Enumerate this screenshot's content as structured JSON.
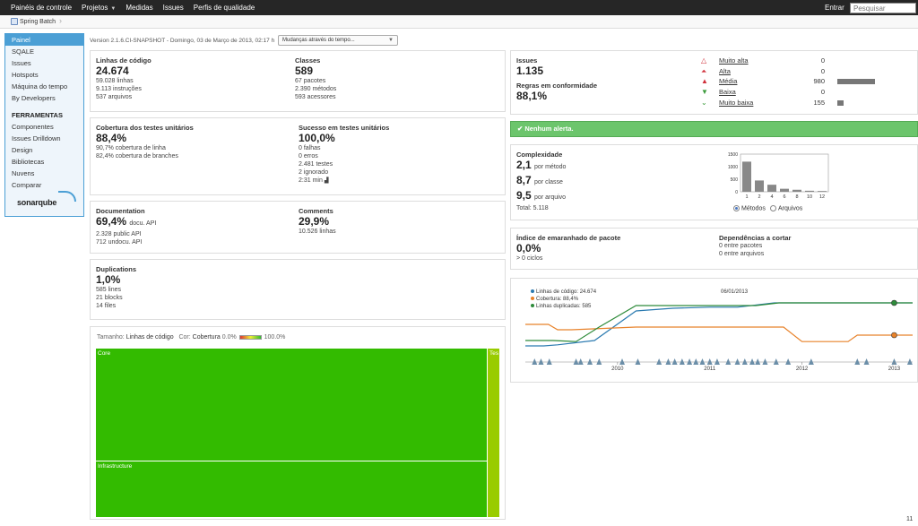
{
  "topnav": {
    "items": [
      "Painéis de controle",
      "Projetos",
      "Medidas",
      "Issues",
      "Perfis de qualidade"
    ],
    "login": "Entrar",
    "search_placeholder": "Pesquisar"
  },
  "breadcrumb": {
    "project": "Spring Batch"
  },
  "sidebar": {
    "items": [
      "Painel",
      "SQALE",
      "Issues",
      "Hotspots",
      "Máquina do tempo",
      "By Developers"
    ],
    "tools_header": "FERRAMENTAS",
    "tools": [
      "Componentes",
      "Issues Drilldown",
      "Design",
      "Bibliotecas",
      "Nuvens",
      "Comparar"
    ],
    "logo": "sonarqube"
  },
  "version_line": "Version 2.1.6.CI-SNAPSHOT - Domingo, 03 de Março de 2013, 02:17 h",
  "compare_dropdown": "Mudanças através do tempo...",
  "size": {
    "loc_title": "Linhas de código",
    "loc_value": "24.674",
    "loc_lines": "59.028 linhas",
    "loc_instr": "9.113 instruções",
    "loc_files": "537 arquivos",
    "classes_title": "Classes",
    "classes_value": "589",
    "classes_pkgs": "67 pacotes",
    "classes_methods": "2.390 métodos",
    "classes_accessors": "593 acessores"
  },
  "tests": {
    "cov_title": "Cobertura dos testes unitários",
    "cov_value": "88,4%",
    "cov_line": "90,7% cobertura de linha",
    "cov_branch": "82,4% cobertura de branches",
    "succ_title": "Sucesso em testes unitários",
    "succ_value": "100,0%",
    "failures": "0 falhas",
    "errors": "0 erros",
    "tests": "2.481 testes",
    "ignored": "2 ignorado",
    "duration": "2:31 min"
  },
  "docs": {
    "doc_title": "Documentation",
    "doc_value": "69,4%",
    "doc_unit": "docu. API",
    "public_api": "2.328 public API",
    "undoc_api": "712 undocu. API",
    "com_title": "Comments",
    "com_value": "29,9%",
    "com_lines": "10.526 linhas"
  },
  "dups": {
    "title": "Duplications",
    "value": "1,0%",
    "lines": "585 lines",
    "blocks": "21 blocks",
    "files": "14 files"
  },
  "treemap": {
    "size_label": "Tamanho:",
    "size_metric": "Linhas de código",
    "color_label": "Cor:",
    "color_metric": "Cobertura",
    "min": "0.0%",
    "max": "100.0%",
    "tiles": [
      "Core",
      "Infrastructure",
      "Tes"
    ]
  },
  "issues": {
    "title": "Issues",
    "value": "1.135",
    "rules_title": "Regras em conformidade",
    "rules_value": "88,1%",
    "severities": [
      {
        "label": "Muito alta",
        "count": "0",
        "fraction": 0,
        "color": "#d02f3a",
        "icon": "blocker-icon"
      },
      {
        "label": "Alta",
        "count": "0",
        "fraction": 0,
        "color": "#d02f3a",
        "icon": "critical-icon"
      },
      {
        "label": "Média",
        "count": "980",
        "fraction": 1.0,
        "color": "#d02f3a",
        "icon": "major-icon"
      },
      {
        "label": "Baixa",
        "count": "0",
        "fraction": 0,
        "color": "#3c9b3c",
        "icon": "minor-icon"
      },
      {
        "label": "Muito baixa",
        "count": "155",
        "fraction": 0.158,
        "color": "#3c9b3c",
        "icon": "info-icon"
      }
    ]
  },
  "alerts": {
    "text": "Nenhum alerta.",
    "color": "#6cc56c"
  },
  "complexity": {
    "title": "Complexidade",
    "per_method": "2,1",
    "per_method_unit": "por método",
    "per_class": "8,7",
    "per_class_unit": "por classe",
    "per_file": "9,5",
    "per_file_unit": "por arquivo",
    "total": "Total: 5.118",
    "radio_methods": "Métodos",
    "radio_files": "Arquivos"
  },
  "tangle": {
    "title": "Índice de emaranhado de pacote",
    "value": "0,0%",
    "cycles": "> 0 ciclos",
    "cut_title": "Dependências a cortar",
    "cut_packages": "0 entre pacotes",
    "cut_files": "0 entre arquivos"
  },
  "chart_data": [
    {
      "type": "bar",
      "categories": [
        "1",
        "2",
        "4",
        "6",
        "8",
        "10",
        "12"
      ],
      "values": [
        1200,
        450,
        280,
        120,
        80,
        40,
        30
      ],
      "ylim": [
        0,
        1500
      ],
      "yticks": [
        "1500",
        "1000",
        "500",
        "0"
      ],
      "bar_color": "#888888"
    },
    {
      "type": "line",
      "legend": [
        "Linhas de código: 24.674",
        "Cobertura: 88,4%",
        "Linhas duplicadas: 585"
      ],
      "date_label": "06/01/2013",
      "x_ticks": [
        "2010",
        "2011",
        "2012",
        "2013"
      ],
      "series": [
        {
          "name": "Linhas de código",
          "color": "#2a7ab0",
          "x": [
            2009.0,
            2009.2,
            2009.35,
            2009.5,
            2009.75,
            2010.2,
            2010.6,
            2011.0,
            2011.3,
            2011.7,
            2012.0,
            2012.5,
            2013.0,
            2013.2
          ],
          "y": [
            0.2,
            0.2,
            0.22,
            0.25,
            0.3,
            0.85,
            0.9,
            0.92,
            0.92,
            1.0,
            1.0,
            1.0,
            1.0,
            1.0
          ]
        },
        {
          "name": "Cobertura",
          "color": "#e8822a",
          "x": [
            2009.0,
            2009.25,
            2009.35,
            2009.5,
            2010.2,
            2010.6,
            2011.0,
            2011.5,
            2011.8,
            2012.0,
            2012.5,
            2012.6,
            2013.0,
            2013.2
          ],
          "y": [
            0.6,
            0.6,
            0.5,
            0.5,
            0.55,
            0.55,
            0.55,
            0.55,
            0.55,
            0.28,
            0.28,
            0.4,
            0.4,
            0.4
          ]
        },
        {
          "name": "Linhas duplicadas",
          "color": "#2e8b3a",
          "x": [
            2009.0,
            2009.3,
            2009.55,
            2009.8,
            2010.2,
            2011.0,
            2011.5,
            2011.75,
            2012.0,
            2012.5,
            2013.0,
            2013.2
          ],
          "y": [
            0.3,
            0.3,
            0.28,
            0.55,
            0.95,
            0.95,
            0.95,
            1.0,
            1.0,
            1.0,
            1.0,
            1.0
          ]
        }
      ],
      "events_x": [
        2009.1,
        2009.17,
        2009.26,
        2009.55,
        2009.6,
        2009.7,
        2009.8,
        2010.05,
        2010.22,
        2010.45,
        2010.55,
        2010.62,
        2010.7,
        2010.78,
        2010.85,
        2010.92,
        2011.0,
        2011.08,
        2011.2,
        2011.3,
        2011.38,
        2011.46,
        2011.52,
        2011.6,
        2011.72,
        2011.85,
        2012.1,
        2012.6,
        2012.7,
        2013.0,
        2013.17
      ],
      "marker_color": "#6b8ea8"
    }
  ],
  "page_number": "11"
}
